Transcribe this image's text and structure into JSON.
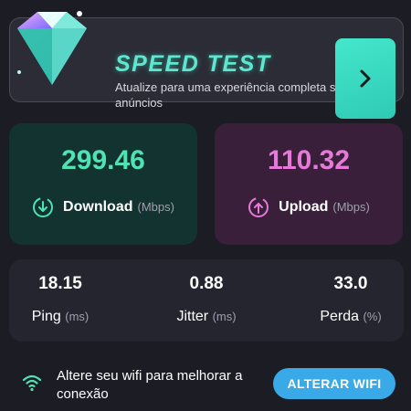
{
  "banner": {
    "title": "SPEED TEST",
    "subtitle": "Atualize para uma experiência completa sem anúncios",
    "action_icon": "chevron-right-icon",
    "accent": "#5fe6cf"
  },
  "download": {
    "value": "299.46",
    "label": "Download",
    "unit": "(Mbps)",
    "icon": "download-arrow-icon",
    "color": "#4fe2b3"
  },
  "upload": {
    "value": "110.32",
    "label": "Upload",
    "unit": "(Mbps)",
    "icon": "upload-arrow-icon",
    "color": "#e77ad9"
  },
  "stats": {
    "ping": {
      "value": "18.15",
      "label": "Ping",
      "unit": "(ms)"
    },
    "jitter": {
      "value": "0.88",
      "label": "Jitter",
      "unit": "(ms)"
    },
    "loss": {
      "value": "33.0",
      "label": "Perda",
      "unit": "(%)"
    }
  },
  "footer": {
    "icon": "wifi-icon",
    "message": "Altere seu wifi para melhorar a conexão",
    "button_label": "ALTERAR WIFI",
    "button_color": "#3aa9e8"
  }
}
